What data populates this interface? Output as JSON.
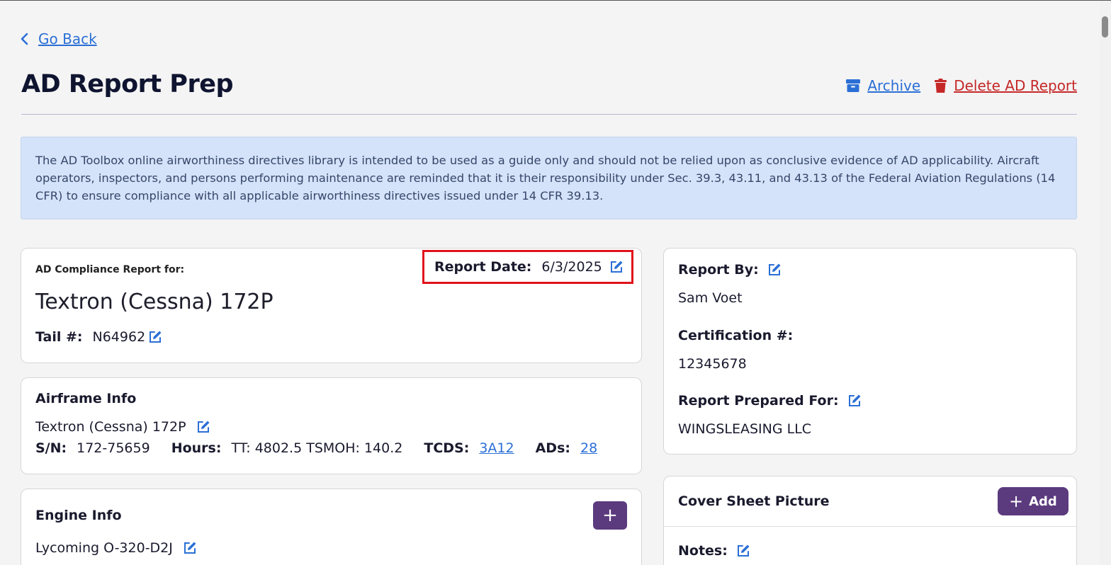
{
  "nav": {
    "back_label": "Go Back"
  },
  "page": {
    "title": "AD Report Prep"
  },
  "actions": {
    "archive_label": "Archive",
    "delete_label": "Delete AD Report"
  },
  "notice": {
    "text": "The AD Toolbox online airworthiness directives library is intended to be used as a guide only and should not be relied upon as conclusive evidence of AD applicability. Aircraft operators, inspectors, and persons performing maintenance are reminded that it is their responsibility under Sec. 39.3, 43.11, and 43.13 of the Federal Aviation Regulations (14 CFR) to ensure compliance with all applicable airworthiness directives issued under 14 CFR 39.13."
  },
  "compliance": {
    "label": "AD Compliance Report for:",
    "aircraft": "Textron (Cessna) 172P",
    "report_date_label": "Report Date:",
    "report_date": "6/3/2025",
    "tail_label": "Tail #:",
    "tail": "N64962"
  },
  "airframe": {
    "heading": "Airframe Info",
    "model": "Textron (Cessna) 172P",
    "sn_label": "S/N:",
    "sn": "172-75659",
    "hours_label": "Hours:",
    "hours": "TT: 4802.5 TSMOH: 140.2",
    "tcds_label": "TCDS:",
    "tcds": "3A12",
    "ads_label": "ADs:",
    "ads": "28"
  },
  "engine": {
    "heading": "Engine Info",
    "add_label": "+",
    "model": "Lycoming O-320-D2J"
  },
  "report_by": {
    "label": "Report By:",
    "name": "Sam Voet",
    "cert_label": "Certification #:",
    "cert": "12345678",
    "prepared_for_label": "Report Prepared For:",
    "prepared_for": "WINGSLEASING LLC"
  },
  "cover": {
    "heading": "Cover Sheet Picture",
    "add_label": "Add",
    "notes_label": "Notes:"
  },
  "colors": {
    "accent": "#5b3a7e",
    "link": "#2b6fd6",
    "danger": "#c62828",
    "highlight": "#e0121a"
  }
}
